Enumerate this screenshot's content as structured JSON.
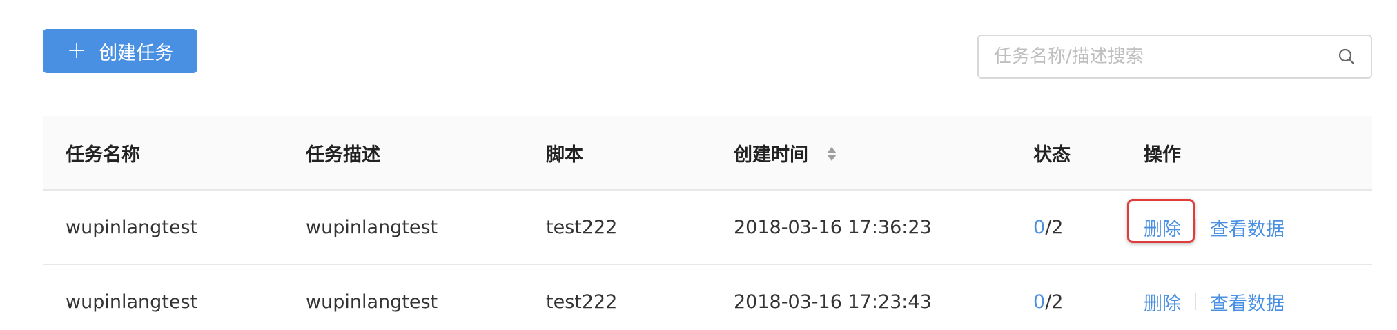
{
  "toolbar": {
    "create_label": "创建任务",
    "create_icon": "plus-icon",
    "search_placeholder": "任务名称/描述搜索",
    "search_value": "",
    "search_icon": "search-icon"
  },
  "table": {
    "columns": [
      "任务名称",
      "任务描述",
      "脚本",
      "创建时间",
      "状态",
      "操作"
    ],
    "sortable_column": "创建时间",
    "rows": [
      {
        "name": "wupinlangtest",
        "description": "wupinlangtest",
        "script": "test222",
        "created": "2018-03-16 17:36:23",
        "status_done": "0",
        "status_total": "/2",
        "delete_label": "删除",
        "view_label": "查看数据",
        "delete_highlighted": true
      },
      {
        "name": "wupinlangtest",
        "description": "wupinlangtest",
        "script": "test222",
        "created": "2018-03-16 17:23:43",
        "status_done": "0",
        "status_total": "/2",
        "delete_label": "删除",
        "view_label": "查看数据",
        "delete_highlighted": false
      }
    ]
  },
  "colors": {
    "primary": "#4a90e2",
    "highlight": "#e03c3c",
    "header_bg": "#fafafa",
    "border": "#e8e8e8"
  }
}
